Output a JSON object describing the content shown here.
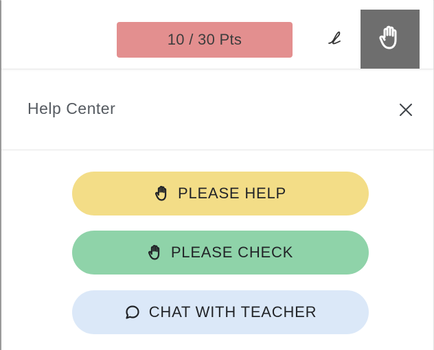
{
  "topbar": {
    "points_label": "10 / 30 Pts",
    "pen_icon": "pen-icon",
    "hand_icon": "raise-hand-icon"
  },
  "panel": {
    "title": "Help Center",
    "close_icon": "close-icon"
  },
  "actions": {
    "help_label": "PLEASE HELP",
    "check_label": "PLEASE CHECK",
    "chat_label": "CHAT WITH TEACHER"
  },
  "colors": {
    "points_bg": "#e38f8f",
    "hand_button_bg": "#6e6e6e",
    "help_bg": "#f3dd87",
    "check_bg": "#8fd3a9",
    "chat_bg": "#dbe8f8"
  }
}
